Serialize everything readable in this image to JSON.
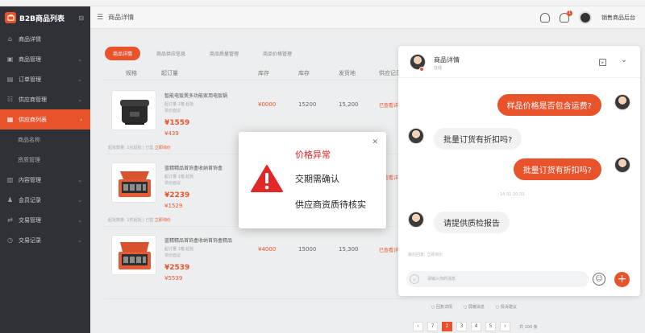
{
  "app": {
    "title": "B2B商品列表"
  },
  "header": {
    "title": "商品详情",
    "username": "销售商品后台",
    "notif_count": "1"
  },
  "sidebar": {
    "items": [
      {
        "label": "商品详情",
        "icon": "home-icon"
      },
      {
        "label": "商品管理",
        "icon": "box-icon"
      },
      {
        "label": "订单管理",
        "icon": "doc-icon"
      },
      {
        "label": "供应商管理",
        "icon": "users-icon"
      },
      {
        "label": "供应商列表",
        "icon": "list-icon"
      },
      {
        "label": "商品名称",
        "icon": ""
      },
      {
        "label": "资质管理",
        "icon": ""
      },
      {
        "label": "内容管理",
        "icon": "content-icon"
      },
      {
        "label": "会员记录",
        "icon": "member-icon"
      },
      {
        "label": "交易管理",
        "icon": "trade-icon"
      },
      {
        "label": "交易记录",
        "icon": "record-icon"
      }
    ]
  },
  "main": {
    "tabs": [
      "商品详情",
      "商品供应信息",
      "商品质量管理",
      "商品价格管理"
    ],
    "columns": [
      "规格",
      "起订量",
      "库存",
      "库存",
      "发货地",
      "供应记录"
    ],
    "products": [
      {
        "name": "智能电饭煲多功能家用电饭锅",
        "meta1": "起订量 1箱 起批",
        "meta2": "单价面议",
        "price": "¥1559",
        "price2": "¥439",
        "stock1": "¥0000",
        "stock2": "15200",
        "ship": "15,200",
        "record": "已查看详情",
        "foot": "起批数量: 1台起批 | 已售",
        "foot_hl": "立即询价"
      },
      {
        "name": "蓝精精品首饰盒收纳首饰盒",
        "meta1": "起订量 1箱 起批",
        "meta2": "单价面议",
        "price": "¥2239",
        "price2": "¥1529",
        "stock1": "",
        "stock2": "",
        "ship": "",
        "record": "已查看详情",
        "foot": "起批数量: 1件起批 | 已售",
        "foot_hl": "立即询价"
      },
      {
        "name": "蓝精精品首饰盒收纳首饰盒精品",
        "meta1": "起订量 1箱 起批",
        "meta2": "单价面议",
        "price": "¥2539",
        "price2": "¥5539",
        "stock1": "¥4000",
        "stock2": "15000",
        "ship": "15,300",
        "record": "已查看详情",
        "foot": "起批数量: 1件起批 | 已售",
        "foot_hl": "立即询价"
      }
    ]
  },
  "chat": {
    "title": "商品详情",
    "status": "在线",
    "messages": [
      {
        "dir": "out",
        "text": "样品价格是否包含运费?"
      },
      {
        "dir": "in",
        "text": "批量订货有折扣吗?"
      },
      {
        "dir": "out",
        "text": "批量订货有折扣吗?"
      },
      {
        "dir": "in",
        "text": "请提供质检报告"
      }
    ],
    "timestamp": "14:31 10:33",
    "sysline": "最后回复: 立即询价",
    "input_placeholder": "请输入你的消息"
  },
  "dialog": {
    "title": "价格异常",
    "line1": "交期需确认",
    "line2": "供应商资质待核实"
  },
  "footer": {
    "links": [
      "○ 回复详情",
      "○ 屏蔽消息",
      "○ 投诉建议"
    ]
  },
  "pager": {
    "pages": [
      "‹",
      "7",
      "2",
      "3",
      "4",
      "5",
      "›"
    ],
    "active": "2",
    "info": "共 100 条"
  },
  "colors": {
    "accent": "#e8532c",
    "sidebar": "#2f3137"
  }
}
